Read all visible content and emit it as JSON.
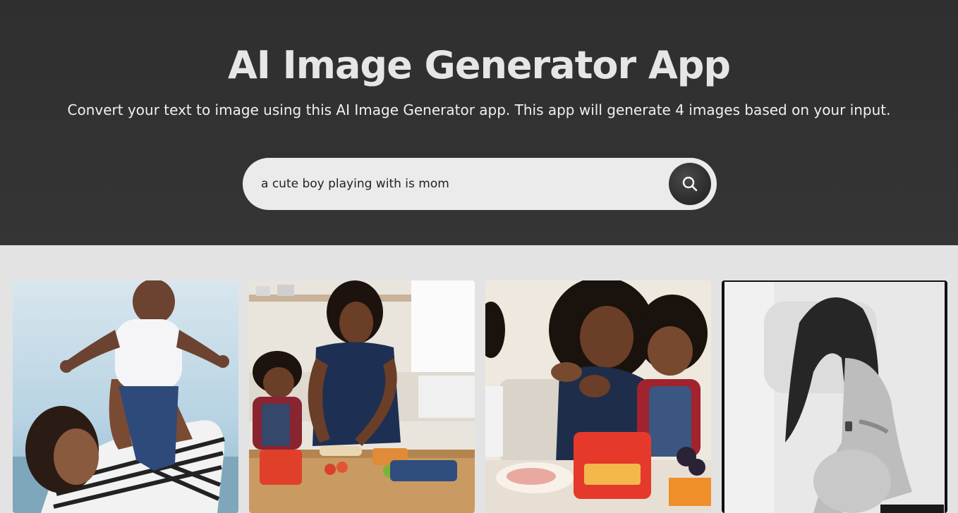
{
  "header": {
    "title": "AI Image Generator App",
    "subtitle": "Convert your text to image using this AI Image Generator app. This app will generate 4 images based on your input."
  },
  "search": {
    "value": "a cute boy playing with is mom",
    "button_icon": "search-icon"
  },
  "gallery": {
    "images": [
      {
        "description": "generated-image-1"
      },
      {
        "description": "generated-image-2"
      },
      {
        "description": "generated-image-3"
      },
      {
        "description": "generated-image-4"
      }
    ]
  },
  "colors": {
    "header_bg": "#323232",
    "page_bg": "#e3e3e3",
    "title": "#e6e6e6",
    "search_bg": "#ebebeb",
    "button_bg": "#2e2e2e"
  }
}
